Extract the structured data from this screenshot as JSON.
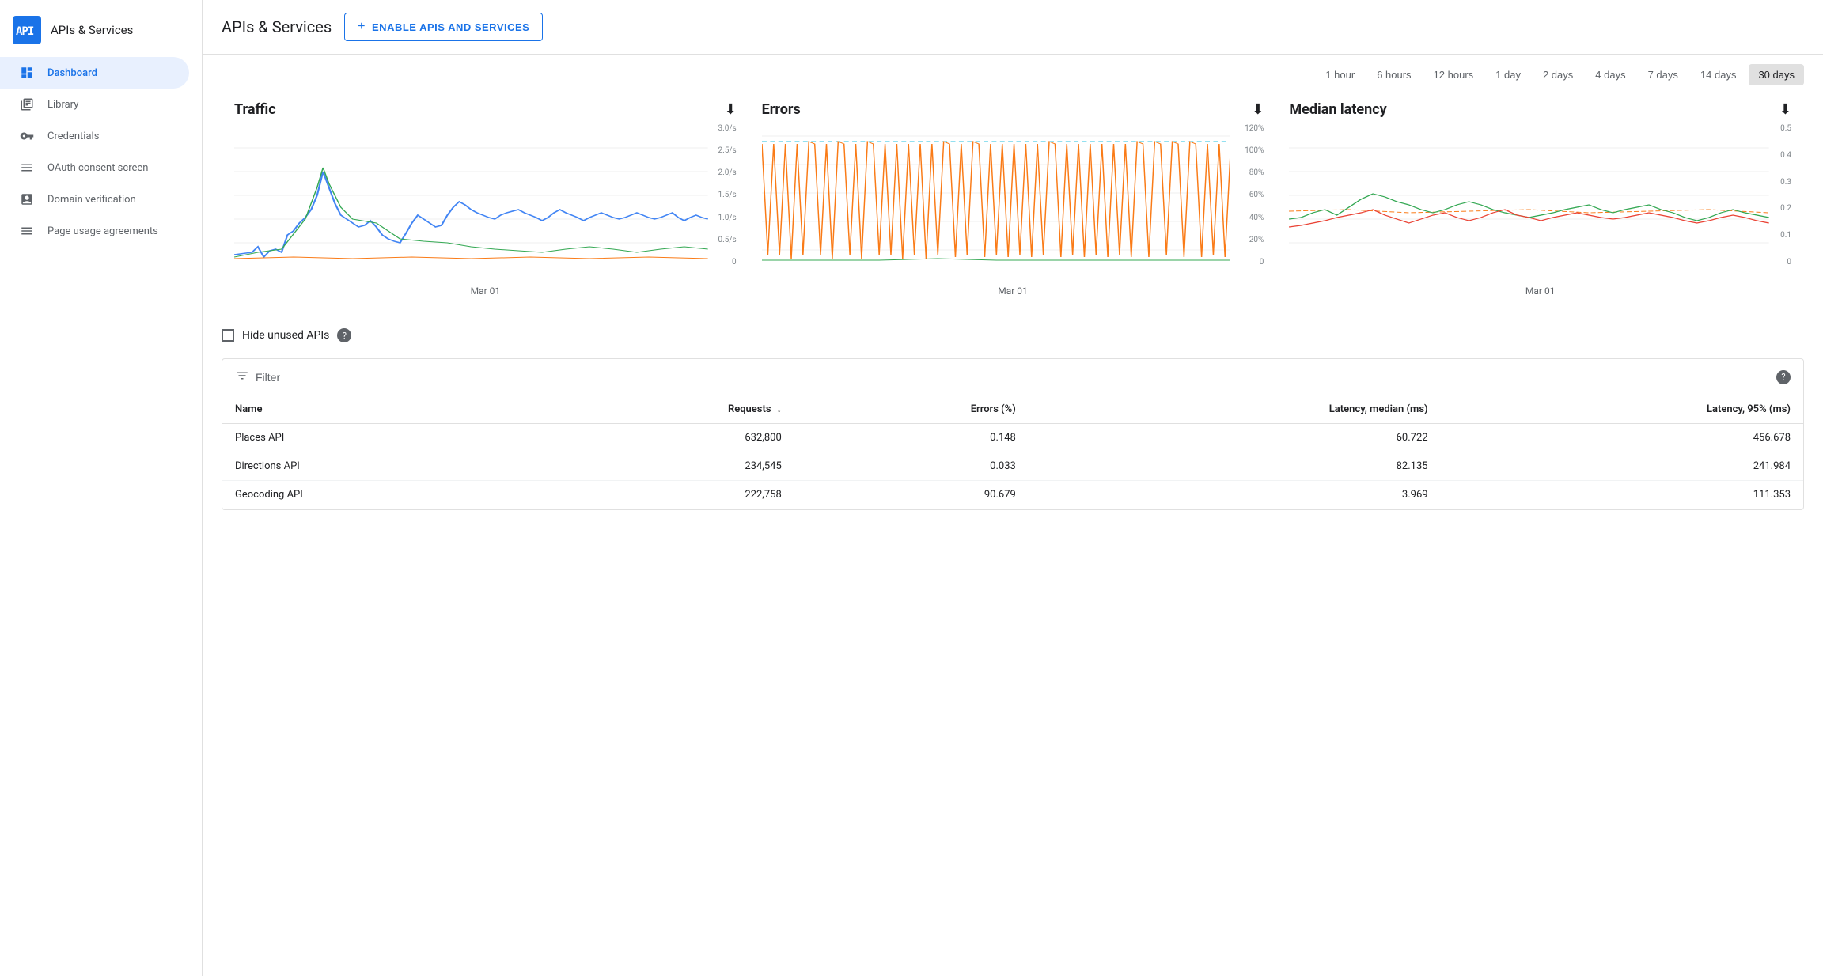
{
  "sidebar": {
    "logo_text": "API",
    "title": "APIs & Services",
    "items": [
      {
        "id": "dashboard",
        "label": "Dashboard",
        "icon": "⬡",
        "active": true
      },
      {
        "id": "library",
        "label": "Library",
        "icon": "▦",
        "active": false
      },
      {
        "id": "credentials",
        "label": "Credentials",
        "icon": "⚷",
        "active": false
      },
      {
        "id": "oauth",
        "label": "OAuth consent screen",
        "icon": "≡",
        "active": false
      },
      {
        "id": "domain",
        "label": "Domain verification",
        "icon": "☑",
        "active": false
      },
      {
        "id": "page-usage",
        "label": "Page usage agreements",
        "icon": "≡",
        "active": false
      }
    ]
  },
  "header": {
    "title": "APIs & Services",
    "enable_button": "ENABLE APIS AND SERVICES"
  },
  "time_range": {
    "options": [
      "1 hour",
      "6 hours",
      "12 hours",
      "1 day",
      "2 days",
      "4 days",
      "7 days",
      "14 days",
      "30 days"
    ],
    "active": "30 days"
  },
  "charts": {
    "traffic": {
      "title": "Traffic",
      "x_label": "Mar 01",
      "y_labels": [
        "3.0/s",
        "2.5/s",
        "2.0/s",
        "1.5/s",
        "1.0/s",
        "0.5/s",
        "0"
      ]
    },
    "errors": {
      "title": "Errors",
      "x_label": "Mar 01",
      "y_labels": [
        "120%",
        "100%",
        "80%",
        "60%",
        "40%",
        "20%",
        "0"
      ]
    },
    "latency": {
      "title": "Median latency",
      "x_label": "Mar 01",
      "y_labels": [
        "0.5",
        "0.4",
        "0.3",
        "0.2",
        "0.1",
        "0"
      ]
    }
  },
  "hide_unused": {
    "label": "Hide unused APIs",
    "checked": false
  },
  "table": {
    "filter_label": "Filter",
    "help_label": "?",
    "columns": [
      {
        "id": "name",
        "label": "Name",
        "sortable": true
      },
      {
        "id": "requests",
        "label": "Requests",
        "sortable": true,
        "align": "right"
      },
      {
        "id": "errors_pct",
        "label": "Errors (%)",
        "sortable": false,
        "align": "right"
      },
      {
        "id": "latency_median",
        "label": "Latency, median (ms)",
        "sortable": false,
        "align": "right"
      },
      {
        "id": "latency_95",
        "label": "Latency, 95% (ms)",
        "sortable": false,
        "align": "right"
      }
    ],
    "rows": [
      {
        "name": "Places API",
        "requests": "632,800",
        "errors_pct": "0.148",
        "latency_median": "60.722",
        "latency_95": "456.678"
      },
      {
        "name": "Directions API",
        "requests": "234,545",
        "errors_pct": "0.033",
        "latency_median": "82.135",
        "latency_95": "241.984"
      },
      {
        "name": "Geocoding API",
        "requests": "222,758",
        "errors_pct": "90.679",
        "latency_median": "3.969",
        "latency_95": "111.353"
      }
    ]
  },
  "colors": {
    "blue": "#1a73e8",
    "active_bg": "#e8f0fe",
    "border": "#e0e0e0",
    "chart_blue": "#4285f4",
    "chart_green": "#34a853",
    "chart_orange": "#fa7b17",
    "chart_red": "#ea4335",
    "chart_teal": "#24c1e0"
  }
}
